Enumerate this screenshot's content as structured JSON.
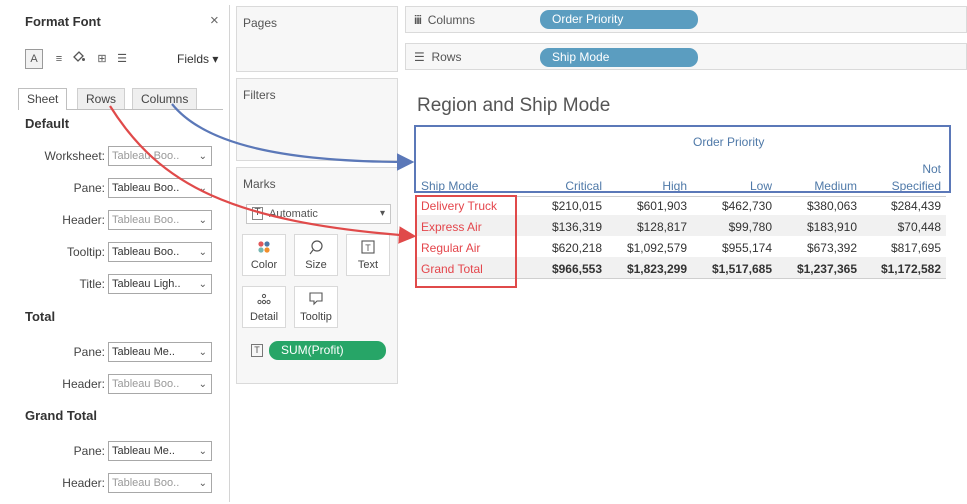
{
  "format_panel": {
    "title": "Format Font",
    "close": "×",
    "tools": {
      "font": "A",
      "align": "≡",
      "shading": "🎨",
      "borders": "⊞",
      "lines": "☰"
    },
    "fields_label": "Fields ▾",
    "tabs": [
      {
        "label": "Sheet",
        "active": true
      },
      {
        "label": "Rows"
      },
      {
        "label": "Columns"
      }
    ],
    "sections": [
      {
        "heading": "Default",
        "rows": [
          {
            "label": "Worksheet:",
            "value": "Tableau Boo..",
            "dim": true
          },
          {
            "label": "Pane:",
            "value": "Tableau Boo..",
            "dim": false
          },
          {
            "label": "Header:",
            "value": "Tableau Boo..",
            "dim": true
          },
          {
            "label": "Tooltip:",
            "value": "Tableau Boo..",
            "dim": false
          },
          {
            "label": "Title:",
            "value": "Tableau Ligh..",
            "dim": false
          }
        ]
      },
      {
        "heading": "Total",
        "rows": [
          {
            "label": "Pane:",
            "value": "Tableau Me..",
            "dim": false
          },
          {
            "label": "Header:",
            "value": "Tableau Boo..",
            "dim": true
          }
        ]
      },
      {
        "heading": "Grand Total",
        "rows": [
          {
            "label": "Pane:",
            "value": "Tableau Me..",
            "dim": false
          },
          {
            "label": "Header:",
            "value": "Tableau Boo..",
            "dim": true
          }
        ]
      }
    ]
  },
  "cards": {
    "pages_title": "Pages",
    "filters_title": "Filters",
    "marks_title": "Marks",
    "mark_type": "Automatic",
    "mark_buttons": [
      {
        "label": "Color",
        "icon": "color-dots-icon"
      },
      {
        "label": "Size",
        "icon": "size-icon"
      },
      {
        "label": "Text",
        "icon": "text-icon"
      },
      {
        "label": "Detail",
        "icon": "detail-icon"
      },
      {
        "label": "Tooltip",
        "icon": "tooltip-icon"
      }
    ],
    "marks_pill": "SUM(Profit)"
  },
  "shelves": {
    "columns_label": "Columns",
    "columns_pill": "Order Priority",
    "rows_label": "Rows",
    "rows_pill": "Ship Mode"
  },
  "viz": {
    "title": "Region and Ship Mode",
    "column_group_header": "Order Priority",
    "row_header_title": "Ship Mode",
    "columns": [
      "Critical",
      "High",
      "Low",
      "Medium",
      "Not Specified"
    ],
    "not_line1": "Not",
    "not_line2": "Specified",
    "rows": [
      {
        "label": "Delivery Truck",
        "values": [
          "$210,015",
          "$601,903",
          "$462,730",
          "$380,063",
          "$284,439"
        ]
      },
      {
        "label": "Express Air",
        "values": [
          "$136,319",
          "$128,817",
          "$99,780",
          "$183,910",
          "$70,448"
        ]
      },
      {
        "label": "Regular Air",
        "values": [
          "$620,218",
          "$1,092,579",
          "$955,174",
          "$673,392",
          "$817,695"
        ]
      },
      {
        "label": "Grand Total",
        "values": [
          "$966,553",
          "$1,823,299",
          "$1,517,685",
          "$1,237,365",
          "$1,172,582"
        ]
      }
    ]
  },
  "annotation_colors": {
    "blue": "#5b78b8",
    "red": "#e04a4a"
  }
}
